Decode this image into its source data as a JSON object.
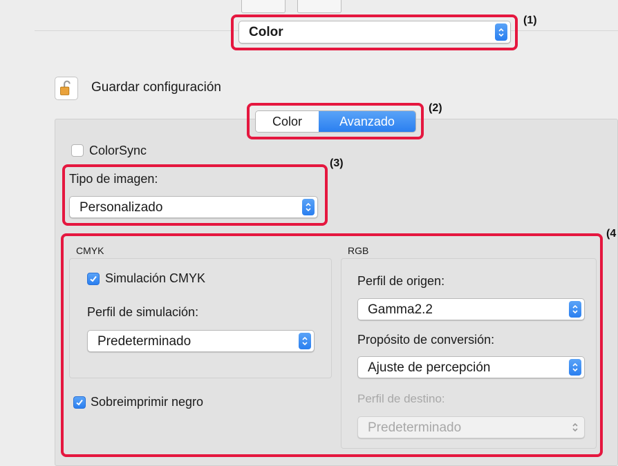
{
  "menu_popup": {
    "value": "Color"
  },
  "lock": {
    "label": "Guardar configuración"
  },
  "segmented": {
    "tabs": [
      "Color",
      "Avanzado"
    ],
    "selected": "Avanzado"
  },
  "colorsync": {
    "label": "ColorSync",
    "checked": false
  },
  "image_type": {
    "label": "Tipo de imagen:",
    "value": "Personalizado"
  },
  "cmyk": {
    "title": "CMYK",
    "simulation": {
      "label": "Simulación CMYK",
      "checked": true
    },
    "profile_label": "Perfil de simulación:",
    "profile_value": "Predeterminado"
  },
  "overprint": {
    "label": "Sobreimprimir negro",
    "checked": true
  },
  "rgb": {
    "title": "RGB",
    "source_label": "Perfil de origen:",
    "source_value": "Gamma2.2",
    "intent_label": "Propósito de conversión:",
    "intent_value": "Ajuste de percepción",
    "dest_label": "Perfil de destino:",
    "dest_value": "Predeterminado"
  },
  "callouts": [
    "(1)",
    "(2)",
    "(3)",
    "(4"
  ],
  "colors": {
    "accent": "#2a7ff0",
    "callout": "#e5173f"
  }
}
